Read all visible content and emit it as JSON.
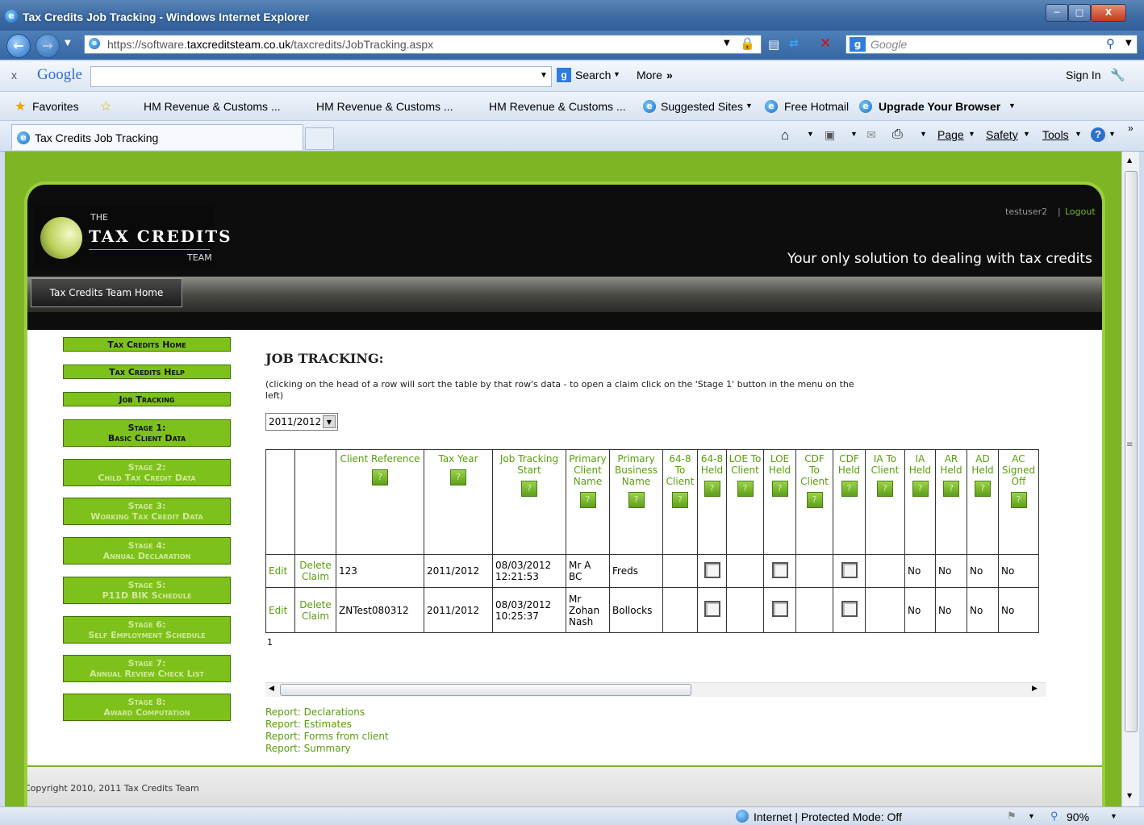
{
  "window": {
    "title": "Tax Credits Job Tracking - Windows Internet Explorer"
  },
  "address": {
    "url_prefix": "https://software.",
    "url_domain": "taxcreditsteam.co.uk",
    "url_path": "/taxcredits/JobTracking.aspx",
    "search_placeholder": "Google"
  },
  "google_toolbar": {
    "close": "x",
    "logo": "Google",
    "search": "Search",
    "more": "More",
    "signin": "Sign In"
  },
  "favorites": {
    "label": "Favorites",
    "items": [
      "HM Revenue & Customs ...",
      "HM Revenue & Customs ...",
      "HM Revenue & Customs ...",
      "Suggested Sites",
      "Free Hotmail",
      "Upgrade Your Browser"
    ]
  },
  "tab": {
    "title": "Tax Credits Job Tracking"
  },
  "command_bar": {
    "page": "Page",
    "safety": "Safety",
    "tools": "Tools"
  },
  "site": {
    "logo_the": "THE",
    "logo_main": "TAX CREDITS",
    "logo_team": "TEAM",
    "user": "testuser2",
    "logout": "Logout",
    "slogan": "Your only solution to dealing with tax credits",
    "home_tab": "Tax Credits Team Home",
    "copyright": "Copyright 2010, 2011 Tax Credits Team"
  },
  "sidebar": [
    {
      "l1": "Tax Credits Home",
      "l2": ""
    },
    {
      "l1": "Tax Credits Help",
      "l2": ""
    },
    {
      "l1": "Job Tracking",
      "l2": ""
    },
    {
      "l1": "Stage 1:",
      "l2": "Basic Client Data"
    },
    {
      "l1": "Stage 2:",
      "l2": "Child Tax Credit Data"
    },
    {
      "l1": "Stage 3:",
      "l2": "Working Tax Credit Data"
    },
    {
      "l1": "Stage 4:",
      "l2": "Annual Declaration"
    },
    {
      "l1": "Stage 5:",
      "l2": "P11D BIK Schedule"
    },
    {
      "l1": "Stage 6:",
      "l2": "Self Employment Schedule"
    },
    {
      "l1": "Stage 7:",
      "l2": "Annual Review Check List"
    },
    {
      "l1": "Stage 8:",
      "l2": "Award Computation"
    }
  ],
  "main": {
    "heading": "JOB TRACKING:",
    "instructions": "(clicking on the head of a row will sort the table by that row's data - to open a claim click on the 'Stage 1' button in the menu on the left)",
    "year_select": "2011/2012",
    "help_icon": "?",
    "columns": [
      "Client Reference",
      "Tax Year",
      "Job Tracking Start",
      "Primary Client Name",
      "Primary Business Name",
      "64-8 To Client",
      "64-8 Held",
      "LOE To Client",
      "LOE Held",
      "CDF To Client",
      "CDF Held",
      "IA To Client",
      "IA Held",
      "AR Held",
      "AD Held",
      "AC Signed Off"
    ],
    "rows": [
      {
        "edit": "Edit",
        "delete": "Delete Claim",
        "ref": "123",
        "year": "2011/2012",
        "start": "08/03/2012 12:21:53",
        "client": "Mr A BC",
        "business": "Freds",
        "ia_held": "No",
        "ar_held": "No",
        "ad_held": "No",
        "ac": "No"
      },
      {
        "edit": "Edit",
        "delete": "Delete Claim",
        "ref": "ZNTest080312",
        "year": "2011/2012",
        "start": "08/03/2012 10:25:37",
        "client": "Mr Zohan Nash",
        "business": "Bollocks",
        "ia_held": "No",
        "ar_held": "No",
        "ad_held": "No",
        "ac": "No"
      }
    ],
    "pager": "1",
    "reports": [
      "Report: Declarations",
      "Report: Estimates",
      "Report: Forms from client",
      "Report: Summary"
    ]
  },
  "statusbar": {
    "zone": "Internet | Protected Mode: Off",
    "zoom": "90%"
  }
}
